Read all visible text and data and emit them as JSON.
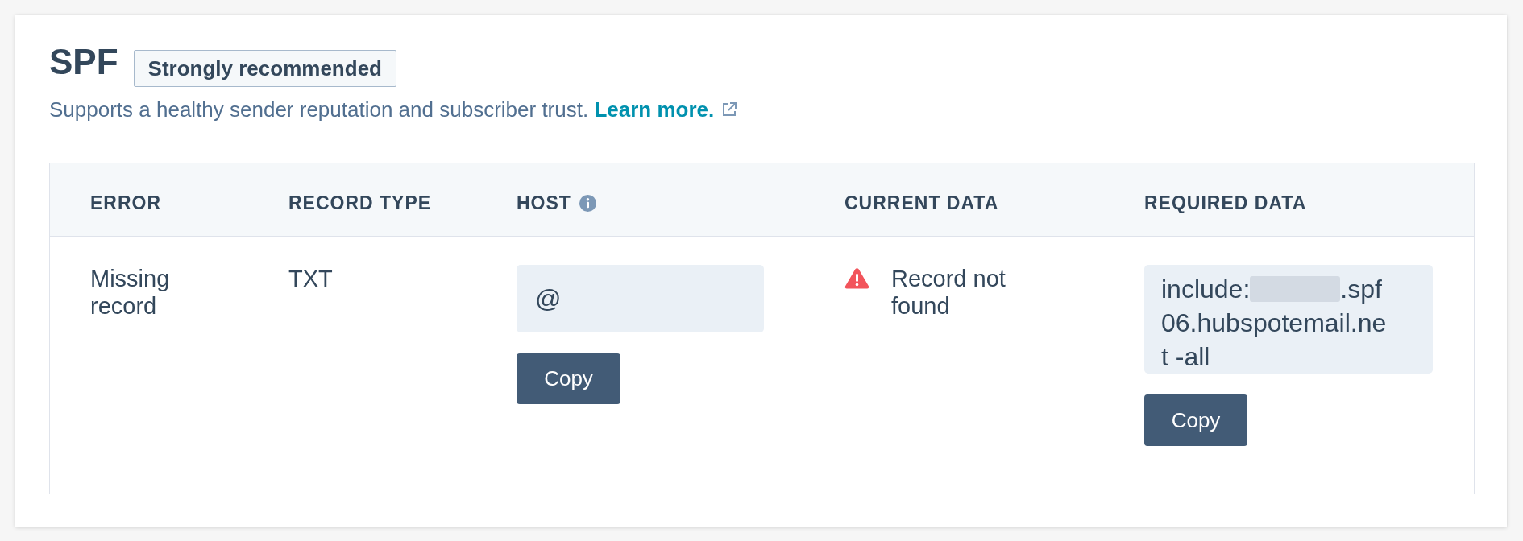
{
  "section": {
    "title": "SPF",
    "badge": "Strongly recommended",
    "description": "Supports a healthy sender reputation and subscriber trust.",
    "link": "Learn more."
  },
  "table": {
    "columns": [
      {
        "label": "ERROR",
        "info": false
      },
      {
        "label": "RECORD TYPE",
        "info": false
      },
      {
        "label": "HOST",
        "info": true
      },
      {
        "label": "CURRENT DATA",
        "info": false
      },
      {
        "label": "REQUIRED DATA",
        "info": false
      }
    ],
    "rows": [
      {
        "error": "Missing record",
        "record_type": "TXT",
        "host": {
          "value": "@",
          "button": "Copy"
        },
        "current_data": {
          "kind": "warning",
          "text": "Record not found"
        },
        "required_data": {
          "value_start": "include:",
          "redacted": true,
          "value_end": ".spf06.hubspotemail.net -all",
          "button": "Copy"
        }
      }
    ]
  }
}
